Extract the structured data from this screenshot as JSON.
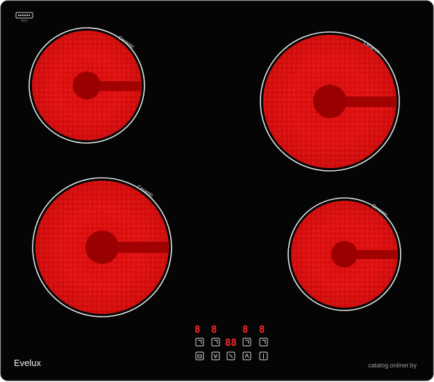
{
  "product": {
    "brand": "Evelux",
    "zone_label": "Ceramic",
    "watermark": "catalog.onliner.by"
  },
  "colors": {
    "glass": "#050505",
    "heating_red": "#e30b0b",
    "heating_dark": "#9a0000",
    "ring": "#e8e8e8",
    "display_red": "#ff2a2a"
  },
  "zones": [
    {
      "id": "front-left",
      "label": "Ceramic"
    },
    {
      "id": "rear-right",
      "label": "Ceramic"
    },
    {
      "id": "rear-left",
      "label": "Ceramic"
    },
    {
      "id": "front-right",
      "label": "Ceramic"
    }
  ],
  "displays": {
    "zone_digits": [
      "8",
      "8",
      "8",
      "8"
    ],
    "timer": "88"
  },
  "controls": {
    "icons": [
      "zone-select-icon",
      "zone-select-icon",
      "zone-select-icon",
      "zone-select-icon",
      "lock-icon",
      "minus-icon",
      "timer-icon",
      "plus-icon",
      "power-icon"
    ]
  }
}
